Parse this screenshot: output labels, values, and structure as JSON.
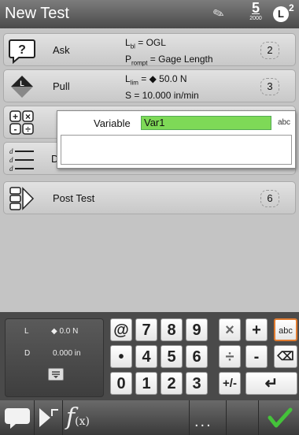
{
  "header": {
    "title": "New Test",
    "five_label": "5",
    "five_sub": "2000",
    "lbadge": "L",
    "lbadge_sup": "2"
  },
  "steps": [
    {
      "label": "Ask",
      "desc1_main": "L",
      "desc1_sub": "bl",
      "desc1_rest": " = OGL",
      "desc2_main": "P",
      "desc2_sub": "rompt",
      "desc2_rest": " = Gage Length",
      "num": "2",
      "icon": "question-icon"
    },
    {
      "label": "Pull",
      "desc1_main": "L",
      "desc1_sub": "lim",
      "desc1_rest": " = ◆ 50.0 N",
      "desc2": "S = 10.000 in/min",
      "num": "3",
      "icon": "pull-icon"
    },
    {
      "label": "Post Test",
      "num": "6",
      "icon": "post-test-icon"
    }
  ],
  "partial_step": {
    "label_initial": "D"
  },
  "popup": {
    "variable_label": "Variable",
    "variable_value": "Var1",
    "abc_label": "abc"
  },
  "readout": {
    "l_label": "L",
    "l_value": "◆ 0.0 N",
    "d_label": "D",
    "d_value": "0.000 in"
  },
  "keypad": {
    "row1": [
      "@",
      "7",
      "8",
      "9",
      "×",
      "+",
      "abc"
    ],
    "row2": [
      "•",
      "4",
      "5",
      "6",
      "÷",
      "-",
      "⌫"
    ],
    "row3": [
      "0",
      "1",
      "2",
      "3",
      "+/-",
      "↵"
    ]
  },
  "bottom": {
    "fx_main": "f",
    "fx_sub": "(x)",
    "more": "..."
  },
  "colors": {
    "accent_green": "#7ed957",
    "check_green": "#44c23a",
    "abc_border": "#e07b30"
  }
}
